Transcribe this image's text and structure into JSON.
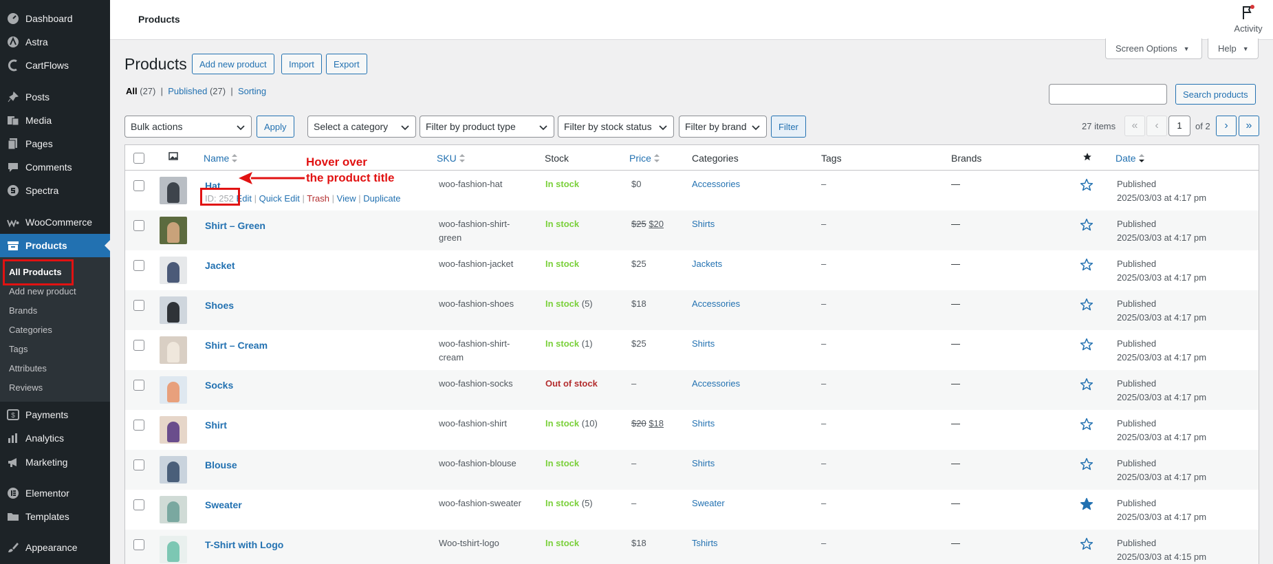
{
  "sidebar": {
    "items": [
      {
        "label": "Dashboard",
        "icon": "dashboard-icon"
      },
      {
        "label": "Astra",
        "icon": "astra-icon"
      },
      {
        "label": "CartFlows",
        "icon": "cartflows-icon"
      },
      {
        "label": "Posts",
        "icon": "pin-icon"
      },
      {
        "label": "Media",
        "icon": "media-icon"
      },
      {
        "label": "Pages",
        "icon": "pages-icon"
      },
      {
        "label": "Comments",
        "icon": "comments-icon"
      },
      {
        "label": "Spectra",
        "icon": "spectra-icon"
      },
      {
        "label": "WooCommerce",
        "icon": "woocommerce-icon"
      },
      {
        "label": "Products",
        "icon": "archive-icon"
      },
      {
        "label": "Payments",
        "icon": "payments-icon"
      },
      {
        "label": "Analytics",
        "icon": "analytics-icon"
      },
      {
        "label": "Marketing",
        "icon": "megaphone-icon"
      },
      {
        "label": "Elementor",
        "icon": "elementor-icon"
      },
      {
        "label": "Templates",
        "icon": "folder-icon"
      },
      {
        "label": "Appearance",
        "icon": "brush-icon"
      }
    ],
    "submenu": [
      "All Products",
      "Add new product",
      "Brands",
      "Categories",
      "Tags",
      "Attributes",
      "Reviews"
    ]
  },
  "topbar": {
    "title": "Products",
    "activity": "Activity"
  },
  "screen_options": "Screen Options",
  "help": "Help",
  "page": {
    "title": "Products",
    "add_new": "Add new product",
    "import": "Import",
    "export": "Export"
  },
  "views": {
    "all": "All",
    "all_count": "(27)",
    "published": "Published",
    "published_count": "(27)",
    "sorting": "Sorting",
    "sep": "|"
  },
  "search": {
    "button": "Search products"
  },
  "filters": {
    "bulk": "Bulk actions",
    "apply": "Apply",
    "category": "Select a category",
    "type": "Filter by product type",
    "stock": "Filter by stock status",
    "brand": "Filter by brand",
    "filter": "Filter"
  },
  "pagination": {
    "items": "27 items",
    "first": "«",
    "prev": "‹",
    "current": "1",
    "of": "of 2",
    "next": "›",
    "last": "»"
  },
  "columns": {
    "name": "Name",
    "sku": "SKU",
    "stock": "Stock",
    "price": "Price",
    "categories": "Categories",
    "tags": "Tags",
    "brands": "Brands",
    "date": "Date"
  },
  "row_actions": {
    "id": "ID: 252",
    "edit": "Edit",
    "quick_edit": "Quick Edit",
    "trash": "Trash",
    "view": "View",
    "duplicate": "Duplicate",
    "sep": "|"
  },
  "annotation": {
    "line1": "Hover over",
    "line2": "the product title"
  },
  "colors": {
    "accent": "#2271b1",
    "in_stock": "#7ad03a",
    "out_of_stock": "#b32d2e",
    "annotation": "#e11212",
    "sidebar": "#1d2327"
  },
  "rows": [
    {
      "name": "Hat",
      "sku1": "woo-fashion-hat",
      "sku2": "",
      "stock": "In stock",
      "stock_qty": "",
      "price_old": "",
      "price": "$0",
      "category": "Accessories",
      "tags": "–",
      "brands": "—",
      "featured": false,
      "status": "Published",
      "date": "2025/03/03 at 4:17 pm"
    },
    {
      "name": "Shirt – Green",
      "sku1": "woo-fashion-shirt-",
      "sku2": "green",
      "stock": "In stock",
      "stock_qty": "",
      "price_old": "$25",
      "price": "$20",
      "category": "Shirts",
      "tags": "–",
      "brands": "—",
      "featured": false,
      "status": "Published",
      "date": "2025/03/03 at 4:17 pm"
    },
    {
      "name": "Jacket",
      "sku1": "woo-fashion-jacket",
      "sku2": "",
      "stock": "In stock",
      "stock_qty": "",
      "price_old": "",
      "price": "$25",
      "category": "Jackets",
      "tags": "–",
      "brands": "—",
      "featured": false,
      "status": "Published",
      "date": "2025/03/03 at 4:17 pm"
    },
    {
      "name": "Shoes",
      "sku1": "woo-fashion-shoes",
      "sku2": "",
      "stock": "In stock",
      "stock_qty": "(5)",
      "price_old": "",
      "price": "$18",
      "category": "Accessories",
      "tags": "–",
      "brands": "—",
      "featured": false,
      "status": "Published",
      "date": "2025/03/03 at 4:17 pm"
    },
    {
      "name": "Shirt – Cream",
      "sku1": "woo-fashion-shirt-",
      "sku2": "cream",
      "stock": "In stock",
      "stock_qty": "(1)",
      "price_old": "",
      "price": "$25",
      "category": "Shirts",
      "tags": "–",
      "brands": "—",
      "featured": false,
      "status": "Published",
      "date": "2025/03/03 at 4:17 pm"
    },
    {
      "name": "Socks",
      "sku1": "woo-fashion-socks",
      "sku2": "",
      "stock": "Out of stock",
      "stock_qty": "",
      "price_old": "",
      "price": "–",
      "category": "Accessories",
      "tags": "–",
      "brands": "—",
      "featured": false,
      "status": "Published",
      "date": "2025/03/03 at 4:17 pm"
    },
    {
      "name": "Shirt",
      "sku1": "woo-fashion-shirt",
      "sku2": "",
      "stock": "In stock",
      "stock_qty": "(10)",
      "price_old": "$20",
      "price": "$18",
      "category": "Shirts",
      "tags": "–",
      "brands": "—",
      "featured": false,
      "status": "Published",
      "date": "2025/03/03 at 4:17 pm"
    },
    {
      "name": "Blouse",
      "sku1": "woo-fashion-blouse",
      "sku2": "",
      "stock": "In stock",
      "stock_qty": "",
      "price_old": "",
      "price": "–",
      "category": "Shirts",
      "tags": "–",
      "brands": "—",
      "featured": false,
      "status": "Published",
      "date": "2025/03/03 at 4:17 pm"
    },
    {
      "name": "Sweater",
      "sku1": "woo-fashion-sweater",
      "sku2": "",
      "stock": "In stock",
      "stock_qty": "(5)",
      "price_old": "",
      "price": "–",
      "category": "Sweater",
      "tags": "–",
      "brands": "—",
      "featured": true,
      "status": "Published",
      "date": "2025/03/03 at 4:17 pm"
    },
    {
      "name": "T-Shirt with Logo",
      "sku1": "Woo-tshirt-logo",
      "sku2": "",
      "stock": "In stock",
      "stock_qty": "",
      "price_old": "",
      "price": "$18",
      "category": "Tshirts",
      "tags": "–",
      "brands": "—",
      "featured": false,
      "status": "Published",
      "date": "2025/03/03 at 4:15 pm"
    }
  ]
}
